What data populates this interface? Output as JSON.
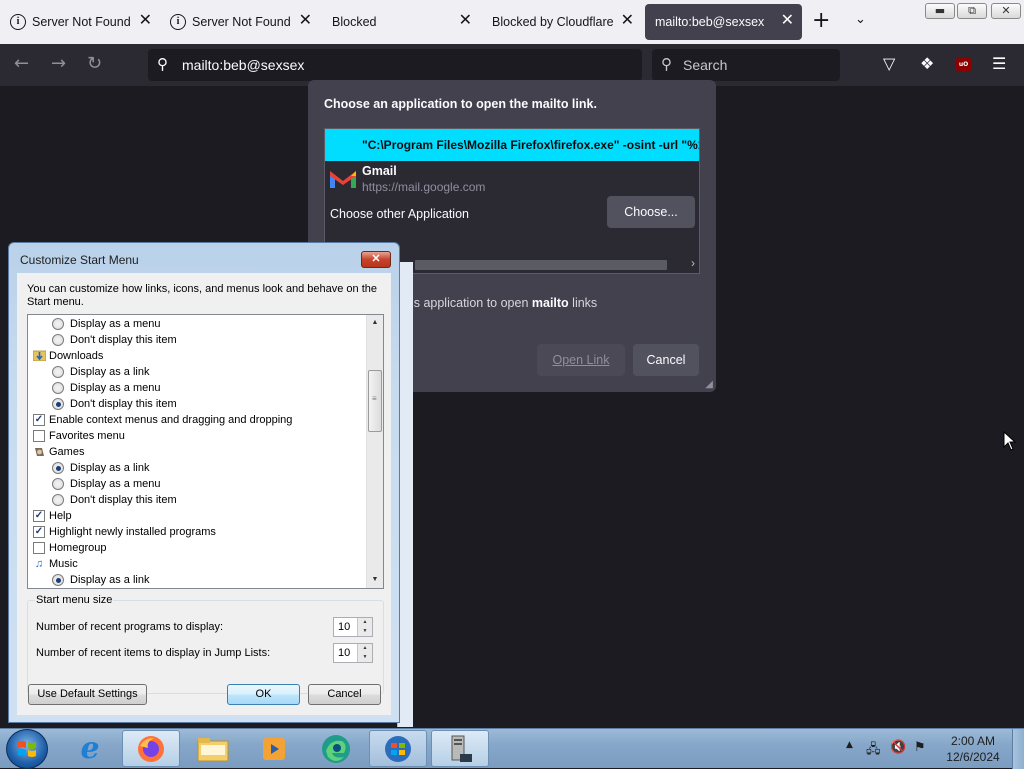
{
  "browser": {
    "tabs": [
      {
        "title": "Server Not Found",
        "icon": "info-icon",
        "active": false
      },
      {
        "title": "Server Not Found",
        "icon": "info-icon",
        "active": false
      },
      {
        "title": "Blocked",
        "icon": "",
        "active": false
      },
      {
        "title": "Blocked by Cloudflare",
        "icon": "",
        "active": false
      },
      {
        "title": "mailto:beb@sexsex",
        "icon": "",
        "active": true
      }
    ],
    "url": "mailto:beb@sexsex",
    "search_placeholder": "Search"
  },
  "mailto_dialog": {
    "heading": "Choose an application to open the mailto link.",
    "apps": [
      {
        "name": "\"C:\\Program Files\\Mozilla Firefox\\firefox.exe\" -osint -url \"%1\"",
        "selected": true
      },
      {
        "name": "Gmail",
        "url": "https://mail.google.com",
        "selected": false
      }
    ],
    "choose_other_label": "Choose other Application",
    "choose_button": "Choose...",
    "remember_prefix": "his application to open ",
    "remember_bold": "mailto",
    "remember_suffix": " links",
    "open_link_button": "Open Link",
    "cancel_button": "Cancel"
  },
  "customize_dialog": {
    "title": "Customize Start Menu",
    "close_glyph": "✕",
    "intro": "You can customize how links, icons, and menus look and behave on the Start menu.",
    "list_items": [
      {
        "kind": "radio",
        "label": "Display as a menu",
        "checked": false,
        "level": 1
      },
      {
        "kind": "radio",
        "label": "Don't display this item",
        "checked": false,
        "level": 1
      },
      {
        "kind": "category",
        "label": "Downloads",
        "icon": "downloads-folder-icon",
        "level": 0
      },
      {
        "kind": "radio",
        "label": "Display as a link",
        "checked": false,
        "level": 1
      },
      {
        "kind": "radio",
        "label": "Display as a menu",
        "checked": false,
        "level": 1
      },
      {
        "kind": "radio",
        "label": "Don't display this item",
        "checked": true,
        "level": 1
      },
      {
        "kind": "checkbox",
        "label": "Enable context menus and dragging and dropping",
        "checked": true,
        "level": 0
      },
      {
        "kind": "checkbox",
        "label": "Favorites menu",
        "checked": false,
        "level": 0
      },
      {
        "kind": "category",
        "label": "Games",
        "icon": "games-icon",
        "level": 0
      },
      {
        "kind": "radio",
        "label": "Display as a link",
        "checked": true,
        "level": 1
      },
      {
        "kind": "radio",
        "label": "Display as a menu",
        "checked": false,
        "level": 1
      },
      {
        "kind": "radio",
        "label": "Don't display this item",
        "checked": false,
        "level": 1
      },
      {
        "kind": "checkbox",
        "label": "Help",
        "checked": true,
        "level": 0
      },
      {
        "kind": "checkbox",
        "label": "Highlight newly installed programs",
        "checked": true,
        "level": 0
      },
      {
        "kind": "checkbox",
        "label": "Homegroup",
        "checked": false,
        "level": 0
      },
      {
        "kind": "category",
        "label": "Music",
        "icon": "music-icon",
        "level": 0
      },
      {
        "kind": "radio",
        "label": "Display as a link",
        "checked": true,
        "level": 1
      }
    ],
    "size_group_label": "Start menu size",
    "recent_programs_label": "Number of recent programs to display:",
    "recent_programs_value": "10",
    "recent_items_label": "Number of recent items to display in Jump Lists:",
    "recent_items_value": "10",
    "default_button": "Use Default Settings",
    "ok_button": "OK",
    "cancel_button": "Cancel"
  },
  "taskbar": {
    "items": [
      {
        "name": "internet-explorer-icon"
      },
      {
        "name": "firefox-icon"
      },
      {
        "name": "file-explorer-icon"
      },
      {
        "name": "media-player-icon"
      },
      {
        "name": "edge-icon"
      },
      {
        "name": "windows-logo-icon"
      },
      {
        "name": "server-icon"
      }
    ],
    "clock_time": "2:00 AM",
    "clock_date": "12/6/2024"
  },
  "colors": {
    "firefox_dark": "#1c1b22",
    "dialog_bg": "#42414d",
    "selection_cyan": "#00ddff",
    "win7_title": "#b9d1ea"
  }
}
